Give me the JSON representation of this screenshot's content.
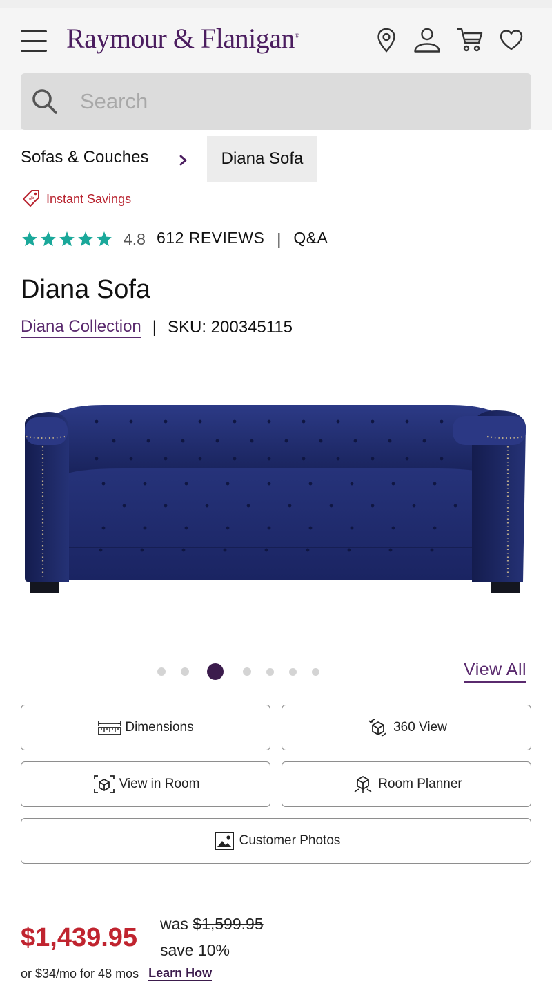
{
  "header": {
    "logo_text": "Raymour & Flanigan",
    "logo_mark": "®",
    "brand_color": "#4b1d5f",
    "icons": [
      "menu-icon",
      "location-pin-icon",
      "account-icon",
      "cart-icon",
      "heart-icon"
    ]
  },
  "search": {
    "placeholder": "Search",
    "value": ""
  },
  "breadcrumb": {
    "parent": "Sofas & Couches",
    "current": "Diana Sofa"
  },
  "promo": {
    "label": "Instant Savings",
    "color": "#b8232f"
  },
  "rating": {
    "stars": 5,
    "score": "4.8",
    "reviews_label": "612 REVIEWS",
    "separator": "|",
    "qa_label": "Q&A",
    "star_color": "#1aa89a"
  },
  "product": {
    "title": "Diana Sofa",
    "collection": "Diana Collection",
    "separator": "|",
    "sku": "SKU: 200345115",
    "image_alt": "Navy tufted Diana Sofa with nailhead trim"
  },
  "gallery": {
    "total_images": 7,
    "active_index": 2,
    "view_all_label": "View All"
  },
  "actions": {
    "dimensions": "Dimensions",
    "view_360": "360 View",
    "view_in_room": "View in Room",
    "room_planner": "Room Planner",
    "customer_photos": "Customer Photos"
  },
  "pricing": {
    "price": "$1,439.95",
    "was_prefix": "was",
    "was_price": "$1,599.95",
    "save": "save 10%",
    "finance": "or $34/mo for 48 mos",
    "learn_how": "Learn How",
    "price_color": "#c0242f"
  }
}
